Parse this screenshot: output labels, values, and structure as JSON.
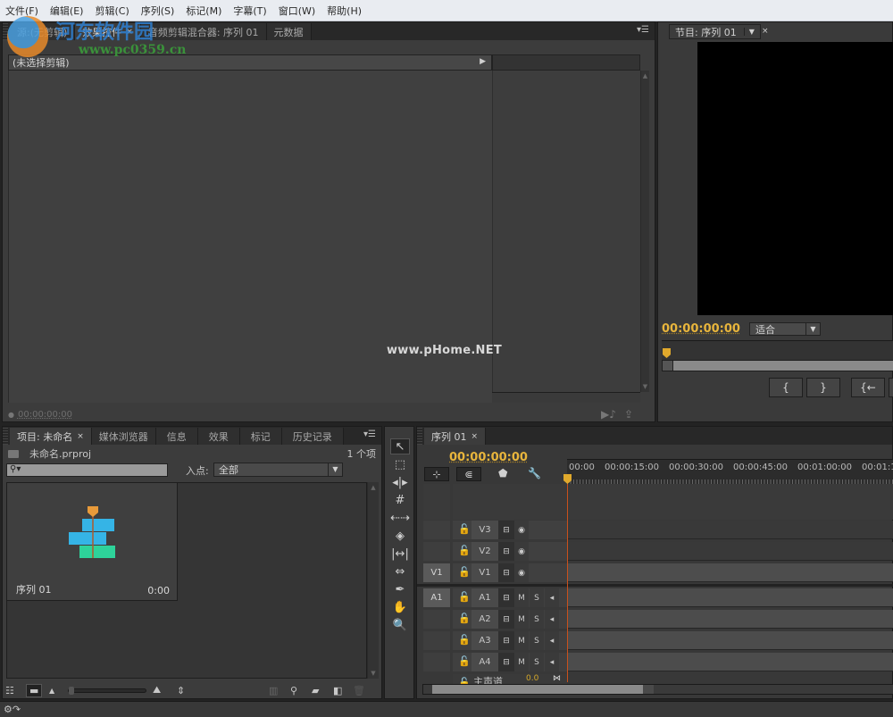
{
  "menubar": {
    "items": [
      "文件(F)",
      "编辑(E)",
      "剪辑(C)",
      "序列(S)",
      "标记(M)",
      "字幕(T)",
      "窗口(W)",
      "帮助(H)"
    ]
  },
  "source_panel": {
    "tabs": [
      {
        "label": "源:(无剪辑)",
        "active": false
      },
      {
        "label": "效果控件",
        "active": true,
        "closable": true
      },
      {
        "label": "音频剪辑混合器: 序列 01",
        "active": false
      },
      {
        "label": "元数据",
        "active": false
      }
    ],
    "header_text": "(未选择剪辑)",
    "timecode": "00:00:00:00"
  },
  "program_monitor": {
    "tab_label": "节目: 序列 01",
    "timecode": "00:00:00:00",
    "fit_option": "适合",
    "buttons": [
      {
        "icon": "mark-in-icon",
        "glyph": "{"
      },
      {
        "icon": "mark-out-icon",
        "glyph": "}"
      },
      {
        "icon": "go-to-in-icon",
        "glyph": "{←"
      }
    ]
  },
  "project_panel": {
    "tabs": [
      {
        "label": "项目: 未命名",
        "active": true,
        "closable": true
      },
      {
        "label": "媒体浏览器",
        "active": false
      },
      {
        "label": "信息",
        "active": false
      },
      {
        "label": "效果",
        "active": false
      },
      {
        "label": "标记",
        "active": false
      },
      {
        "label": "历史记录",
        "active": false
      }
    ],
    "project_file": "未命名.prproj",
    "item_count": "1 个项",
    "search_placeholder": "",
    "inpoint_label": "入点:",
    "inpoint_value": "全部",
    "items": [
      {
        "name": "序列 01",
        "duration": "0:00"
      }
    ]
  },
  "tools": [
    "selection-tool",
    "track-select-tool",
    "ripple-edit-tool",
    "rolling-edit-tool",
    "rate-stretch-tool",
    "razor-tool",
    "slip-tool",
    "slide-tool",
    "pen-tool",
    "hand-tool",
    "zoom-tool"
  ],
  "timeline": {
    "tab_label": "序列 01",
    "timecode": "00:00:00:00",
    "ruler_labels": [
      "00:00",
      "00:00:15:00",
      "00:00:30:00",
      "00:00:45:00",
      "00:01:00:00",
      "00:01:1"
    ],
    "video_tracks": [
      {
        "name": "V3",
        "source": ""
      },
      {
        "name": "V2",
        "source": ""
      },
      {
        "name": "V1",
        "source": "V1"
      }
    ],
    "audio_tracks": [
      {
        "name": "A1",
        "source": "A1"
      },
      {
        "name": "A2",
        "source": ""
      },
      {
        "name": "A3",
        "source": ""
      },
      {
        "name": "A4",
        "source": ""
      }
    ],
    "master_label": "主声道",
    "master_value": "0.0",
    "mute_label": "M",
    "solo_label": "S"
  },
  "watermarks": {
    "site_cn": "河东软件园",
    "site_url": "www.pc0359.cn",
    "phome": "www.pHome.NET"
  }
}
